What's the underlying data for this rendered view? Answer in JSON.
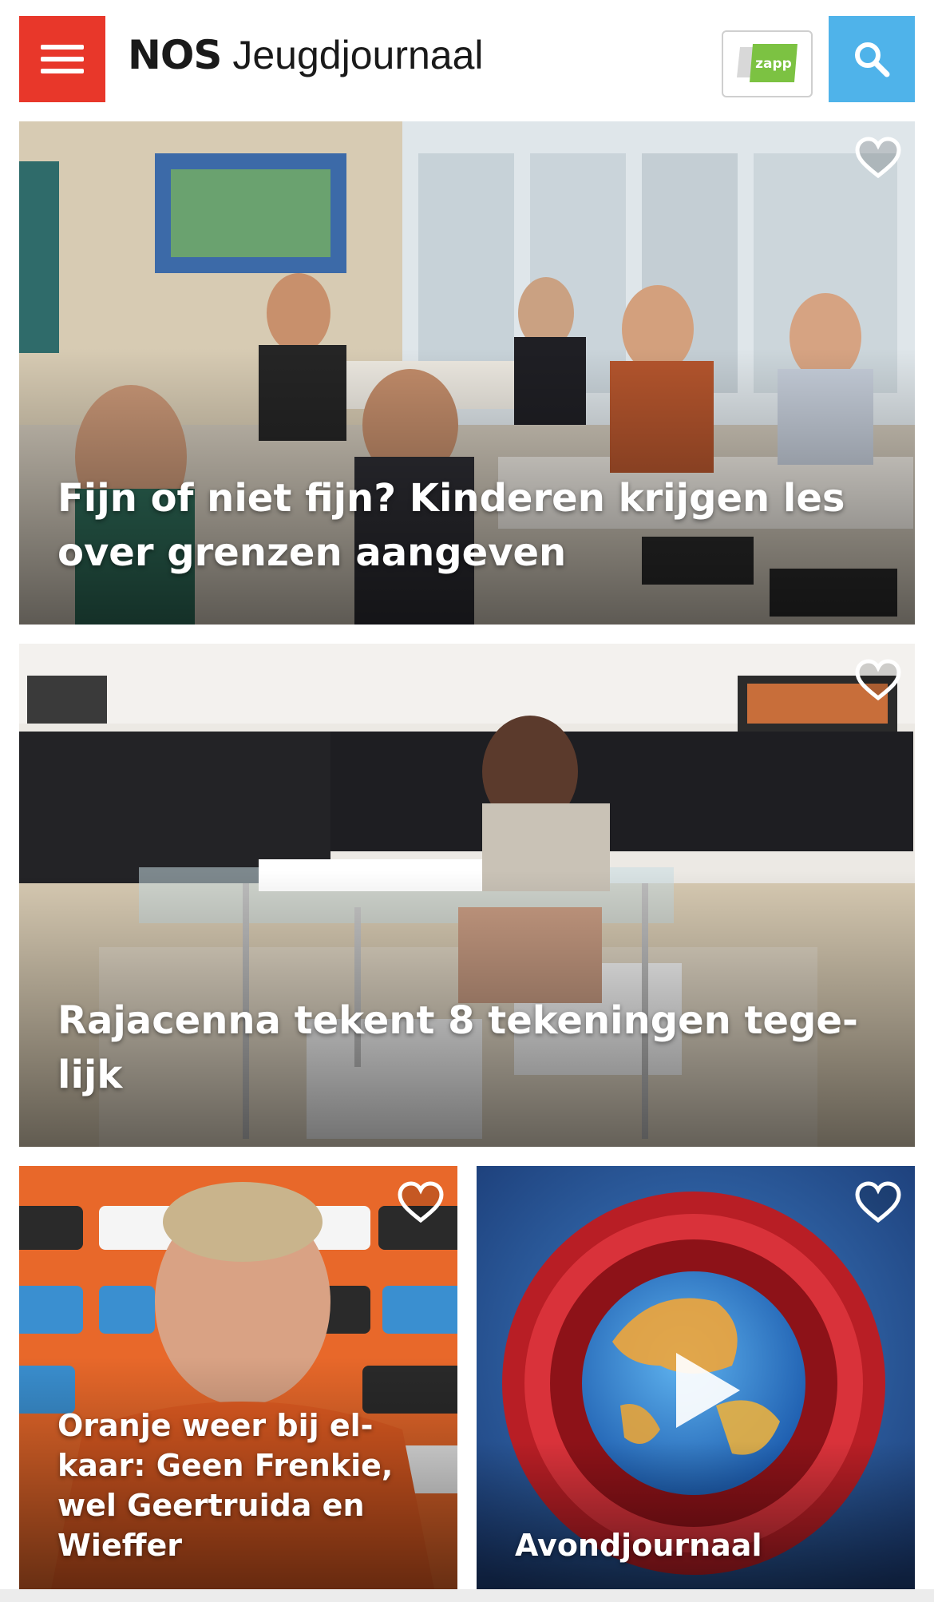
{
  "header": {
    "logo_brand": "NOS",
    "logo_title": "Jeugdjournaal",
    "zapp_badge_label": "zapp"
  },
  "colors": {
    "menu_button": "#e8372a",
    "search_button": "#4fb3ea",
    "zapp_green": "#7cc242"
  },
  "articles": [
    {
      "title": "Fijn of niet fijn? Kinderen krijgen les over grenzen aangeven",
      "favorite_icon": "heart-outline-icon"
    },
    {
      "title": "Rajacenna tekent 8 tekeningen tege-lijk",
      "favorite_icon": "heart-outline-icon"
    },
    {
      "title": "Oranje weer bij el-kaar: Geen Frenkie, wel Geertruida en Wieffer",
      "favorite_icon": "heart-outline-icon"
    },
    {
      "title": "Avondjournaal",
      "favorite_icon": "heart-outline-icon",
      "media_icon": "play-icon"
    }
  ]
}
